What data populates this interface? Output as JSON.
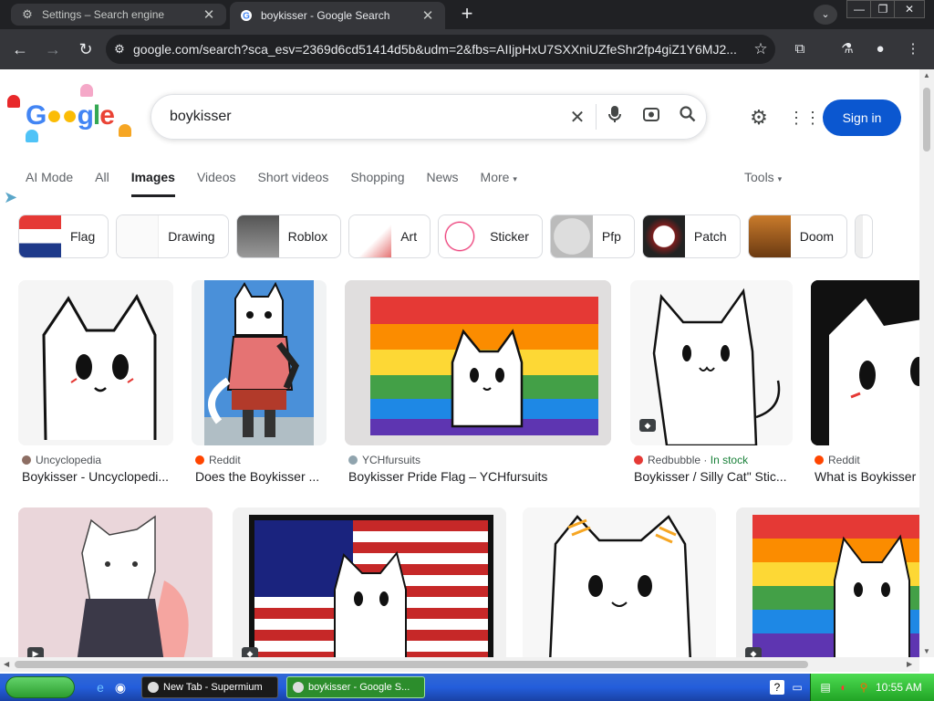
{
  "browser": {
    "tabs": [
      {
        "label": "Settings – Search engine",
        "icon": "gear-icon"
      },
      {
        "label": "boykisser - Google Search",
        "icon": "google-icon"
      }
    ],
    "url": "google.com/search?sca_esv=2369d6cd51414d5b&udm=2&fbs=AIIjpHxU7SXXniUZfeShr2fp4giZ1Y6MJ2..."
  },
  "search": {
    "logo": "Google",
    "query": "boykisser",
    "signin_label": "Sign in"
  },
  "navtabs": [
    "AI Mode",
    "All",
    "Images",
    "Videos",
    "Short videos",
    "Shopping",
    "News",
    "More"
  ],
  "tools_label": "Tools",
  "chips": [
    "Flag",
    "Drawing",
    "Roblox",
    "Art",
    "Sticker",
    "Pfp",
    "Patch",
    "Doom"
  ],
  "results_row1": [
    {
      "source": "Uncyclopedia",
      "title": "Boykisser - Uncyclopedi..."
    },
    {
      "source": "Reddit",
      "title": "Does the Boykisser ..."
    },
    {
      "source": "YCHfursuits",
      "title": "Boykisser Pride Flag – YCHfursuits"
    },
    {
      "source": "Redbubble",
      "stock": "In stock",
      "title": "Boykisser / Silly Cat\" Stic..."
    },
    {
      "source": "Reddit",
      "title": "What is Boykisser"
    }
  ],
  "taskbar": {
    "tasks": [
      "New Tab - Supermium",
      "boykisser - Google S..."
    ],
    "clock": "10:55 AM"
  },
  "colors": {
    "accent": "#0b57d0",
    "chrome_dark": "#202124",
    "taskbar_blue": "#245edb",
    "in_stock": "#188038"
  }
}
